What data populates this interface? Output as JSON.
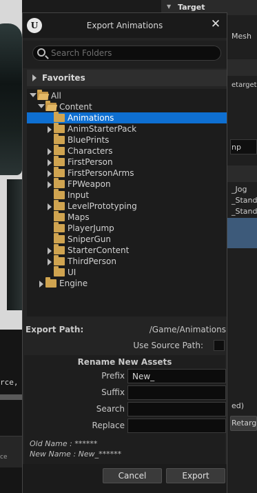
{
  "background": {
    "code_fragment": "rce,",
    "panel_fragment": "ce",
    "right": {
      "header": "Target",
      "mesh": "Mesh",
      "retarget": "etargete",
      "field": "np",
      "items": [
        "_Jog",
        "_Stand",
        "_Stand"
      ],
      "ed": "ed)",
      "button": "Retarg"
    }
  },
  "dialog": {
    "title": "Export Animations",
    "search_placeholder": "Search Folders",
    "favorites": "Favorites",
    "tree": [
      {
        "label": "All",
        "depth": 0,
        "expander": "open"
      },
      {
        "label": "Content",
        "depth": 1,
        "expander": "open"
      },
      {
        "label": "Animations",
        "depth": 2,
        "expander": "none",
        "selected": true
      },
      {
        "label": "AnimStarterPack",
        "depth": 2,
        "expander": "closed"
      },
      {
        "label": "BluePrints",
        "depth": 2,
        "expander": "none"
      },
      {
        "label": "Characters",
        "depth": 2,
        "expander": "closed"
      },
      {
        "label": "FirstPerson",
        "depth": 2,
        "expander": "closed"
      },
      {
        "label": "FirstPersonArms",
        "depth": 2,
        "expander": "closed"
      },
      {
        "label": "FPWeapon",
        "depth": 2,
        "expander": "closed"
      },
      {
        "label": "Input",
        "depth": 2,
        "expander": "none"
      },
      {
        "label": "LevelPrototyping",
        "depth": 2,
        "expander": "closed"
      },
      {
        "label": "Maps",
        "depth": 2,
        "expander": "none"
      },
      {
        "label": "PlayerJump",
        "depth": 2,
        "expander": "none"
      },
      {
        "label": "SniperGun",
        "depth": 2,
        "expander": "none"
      },
      {
        "label": "StarterContent",
        "depth": 2,
        "expander": "closed"
      },
      {
        "label": "ThirdPerson",
        "depth": 2,
        "expander": "closed"
      },
      {
        "label": "UI",
        "depth": 2,
        "expander": "none"
      },
      {
        "label": "Engine",
        "depth": 1,
        "expander": "closed"
      }
    ],
    "export_path_label": "Export Path:",
    "export_path_value": "/Game/Animations",
    "use_source_path_label": "Use Source Path:",
    "use_source_path_checked": false,
    "rename": {
      "heading": "Rename New Assets",
      "prefix_label": "Prefix",
      "prefix_value": "New_",
      "suffix_label": "Suffix",
      "suffix_value": "",
      "search_label": "Search",
      "search_value": "",
      "replace_label": "Replace",
      "replace_value": "",
      "old_name": "Old Name : ******",
      "new_name": "New Name : New_******"
    },
    "cancel": "Cancel",
    "export": "Export"
  }
}
